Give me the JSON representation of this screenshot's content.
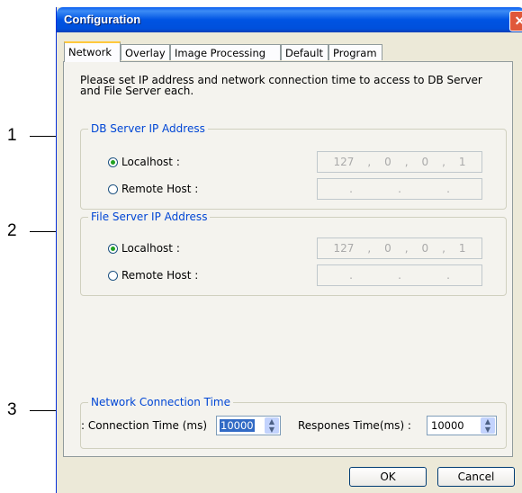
{
  "window": {
    "title": "Configuration",
    "close_glyph": "✕"
  },
  "tabs": [
    "Network",
    "Overlay",
    "Image Processing",
    "Default",
    "Program"
  ],
  "description": "Please set IP address and network connection time to access to DB Server and File Server each.",
  "db_group": {
    "title": "DB Server IP Address",
    "localhost_label": "Localhost :",
    "remote_label": "Remote Host :",
    "local_ip": [
      "127",
      "0",
      "0",
      "1"
    ],
    "selected": "localhost"
  },
  "file_group": {
    "title": "File Server IP Address",
    "localhost_label": "Localhost :",
    "remote_label": "Remote Host :",
    "local_ip": [
      "127",
      "0",
      "0",
      "1"
    ],
    "selected": "localhost"
  },
  "net_group": {
    "title": "Network Connection Time",
    "connection_label": "Connection Time (ms) :",
    "connection_value": "10000",
    "response_label": "Respones Time(ms) :",
    "response_value": "10000"
  },
  "buttons": {
    "ok": "OK",
    "cancel": "Cancel"
  },
  "callouts": [
    "1",
    "2",
    "3"
  ],
  "colors": {
    "title_bar": "#0054e3",
    "group_title": "#0046d5",
    "active_tab_highlight": "#ffc83c"
  }
}
